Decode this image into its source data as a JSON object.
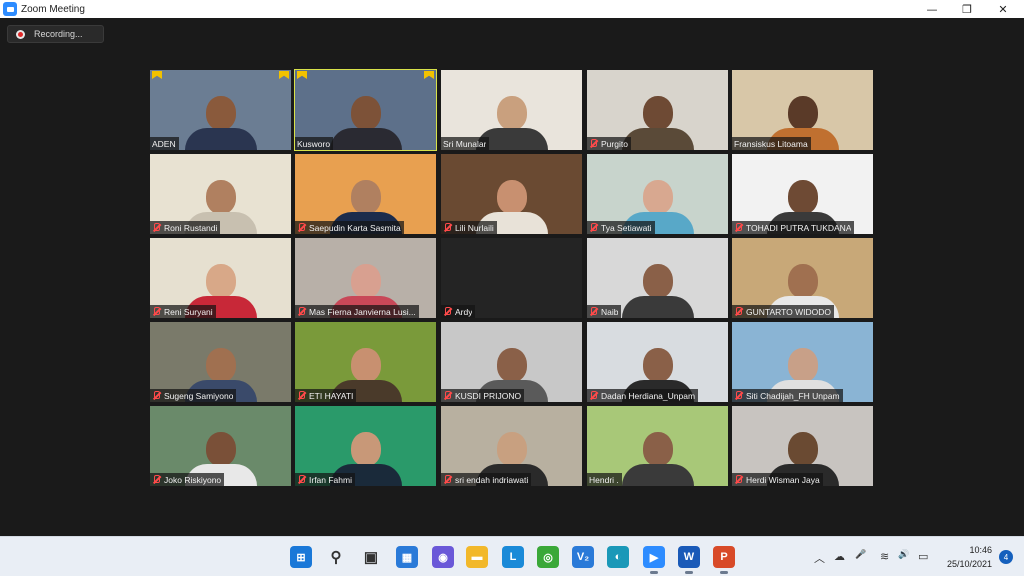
{
  "window": {
    "title": "Zoom Meeting",
    "controls": {
      "minimize": "—",
      "restore": "❐",
      "close": "✕"
    }
  },
  "recording": {
    "label": "Recording..."
  },
  "participants": [
    {
      "name": "ADEN",
      "muted": false,
      "video_on": true,
      "pinned": true,
      "bg": "#6b7d93",
      "skin": "#8a5a3c",
      "shirt": "#2a3550"
    },
    {
      "name": "Kusworo",
      "muted": false,
      "video_on": true,
      "pinned": true,
      "active_speaker": true,
      "bg": "#5d708a",
      "skin": "#7d5238",
      "shirt": "#2a2a32"
    },
    {
      "name": "Sri Munalar",
      "muted": false,
      "video_on": true,
      "bg": "#e9e4dc",
      "skin": "#c9a07e",
      "shirt": "#3a3a3a"
    },
    {
      "name": "Purgito",
      "muted": true,
      "video_on": true,
      "bg": "#d8d4cc",
      "skin": "#6e4a34",
      "shirt": "#5a4a38"
    },
    {
      "name": "Fransiskus Litoama",
      "muted": false,
      "video_on": true,
      "bg": "#d8c7a8",
      "skin": "#5a3a28",
      "shirt": "#c07030"
    },
    {
      "name": "Roni Rustandi",
      "muted": true,
      "video_on": true,
      "bg": "#e8e2d2",
      "skin": "#b08060",
      "shirt": "#c8c0b0"
    },
    {
      "name": "Saepudin Karta Sasmita",
      "muted": true,
      "video_on": true,
      "bg": "#e8a050",
      "skin": "#b08060",
      "shirt": "#1c2c4c"
    },
    {
      "name": "Lili Nurlaili",
      "muted": true,
      "video_on": true,
      "bg": "#6a4a32",
      "skin": "#c89070",
      "shirt": "#e8e2d8"
    },
    {
      "name": "Tya Setiawati",
      "muted": true,
      "video_on": true,
      "bg": "#c8d4cc",
      "skin": "#d8a890",
      "shirt": "#58a8c8"
    },
    {
      "name": "TOHADI PUTRA TUKDANA",
      "muted": true,
      "video_on": true,
      "bg": "#f2f2f2",
      "skin": "#6e4a34",
      "shirt": "#3a3a3a"
    },
    {
      "name": "Reni Suryani",
      "muted": true,
      "video_on": true,
      "bg": "#e6e0d0",
      "skin": "#d8a888",
      "shirt": "#c82838"
    },
    {
      "name": "Mas Fierna Janvierna Lusi...",
      "muted": true,
      "video_on": true,
      "bg": "#b8b0a8",
      "skin": "#d8a090",
      "shirt": "#c84858"
    },
    {
      "name": "Ardy",
      "muted": true,
      "video_on": false,
      "bg": "#242424",
      "skin": "#242424",
      "shirt": "#242424"
    },
    {
      "name": "Naib",
      "muted": true,
      "video_on": true,
      "bg": "#d8d8d8",
      "skin": "#8a6048",
      "shirt": "#3a3a3a"
    },
    {
      "name": "GUNTARTO WIDODO",
      "muted": true,
      "video_on": true,
      "bg": "#c8a878",
      "skin": "#a07050",
      "shirt": "#e8e8e8"
    },
    {
      "name": "Sugeng Samiyono",
      "muted": true,
      "video_on": true,
      "bg": "#7a7a6a",
      "skin": "#a07050",
      "shirt": "#3a4a6a"
    },
    {
      "name": "ETI HAYATI",
      "muted": true,
      "video_on": true,
      "bg": "#7a9a3a",
      "skin": "#c89070",
      "shirt": "#4a3a2a"
    },
    {
      "name": "KUSDI PRIJONO",
      "muted": true,
      "video_on": true,
      "bg": "#c8c8c8",
      "skin": "#8a6048",
      "shirt": "#5a5a5a"
    },
    {
      "name": "Dadan Herdiana_Unpam",
      "muted": true,
      "video_on": true,
      "bg": "#d8dce0",
      "skin": "#8a6048",
      "shirt": "#2a2a2a"
    },
    {
      "name": "Siti Chadijah_FH Unpam",
      "muted": true,
      "video_on": true,
      "bg": "#8ab4d4",
      "skin": "#c8a088",
      "shirt": "#e0e0e0"
    },
    {
      "name": "Joko Riskiyono",
      "muted": true,
      "video_on": true,
      "bg": "#6a8a6a",
      "skin": "#7a5038",
      "shirt": "#e8e8e8"
    },
    {
      "name": "Irfan Fahmi",
      "muted": true,
      "video_on": true,
      "bg": "#2a9a6a",
      "skin": "#c89878",
      "shirt": "#1a2a3a"
    },
    {
      "name": "sri endah indriawati",
      "muted": true,
      "video_on": true,
      "bg": "#b8b0a0",
      "skin": "#c8a080",
      "shirt": "#2a2a2a"
    },
    {
      "name": "Hendri .",
      "muted": false,
      "video_on": true,
      "bg": "#a8c878",
      "skin": "#8a6048",
      "shirt": "#3a3a3a"
    },
    {
      "name": "Herdi Wisman Jaya",
      "muted": true,
      "video_on": true,
      "bg": "#c8c4c0",
      "skin": "#6a4a32",
      "shirt": "#2a2a2a"
    }
  ],
  "taskbar": {
    "apps": [
      {
        "name": "windows-start",
        "glyph": "⊞",
        "color": "#1a78d8"
      },
      {
        "name": "search",
        "glyph": "⚲",
        "color": "#333333"
      },
      {
        "name": "task-view",
        "glyph": "▣",
        "color": "#333333"
      },
      {
        "name": "widgets",
        "glyph": "▦",
        "color": "#2a7ad8"
      },
      {
        "name": "chat",
        "glyph": "◉",
        "color": "#6a58d8"
      },
      {
        "name": "file-explorer",
        "glyph": "▬",
        "color": "#f2b82a"
      },
      {
        "name": "lark",
        "glyph": "L",
        "color": "#1a8ad8"
      },
      {
        "name": "chrome",
        "glyph": "◎",
        "color": "#3aa838"
      },
      {
        "name": "vscode-like",
        "glyph": "V₂",
        "color": "#2a7ad8"
      },
      {
        "name": "edge",
        "glyph": "◐",
        "color": "#1a98b8"
      },
      {
        "name": "zoom",
        "glyph": "▶",
        "color": "#2d8cff",
        "active": true
      },
      {
        "name": "word",
        "glyph": "W",
        "color": "#1a5ab8",
        "active": true
      },
      {
        "name": "powerpoint",
        "glyph": "P",
        "color": "#d84a28",
        "active": true
      }
    ],
    "tray": {
      "chevron": "︿",
      "cloud": "☁",
      "mic": "🎤",
      "wifi": "≋",
      "volume": "🔊",
      "battery": "▭"
    },
    "time": "10:46",
    "date": "25/10/2021",
    "notifications": "4"
  }
}
